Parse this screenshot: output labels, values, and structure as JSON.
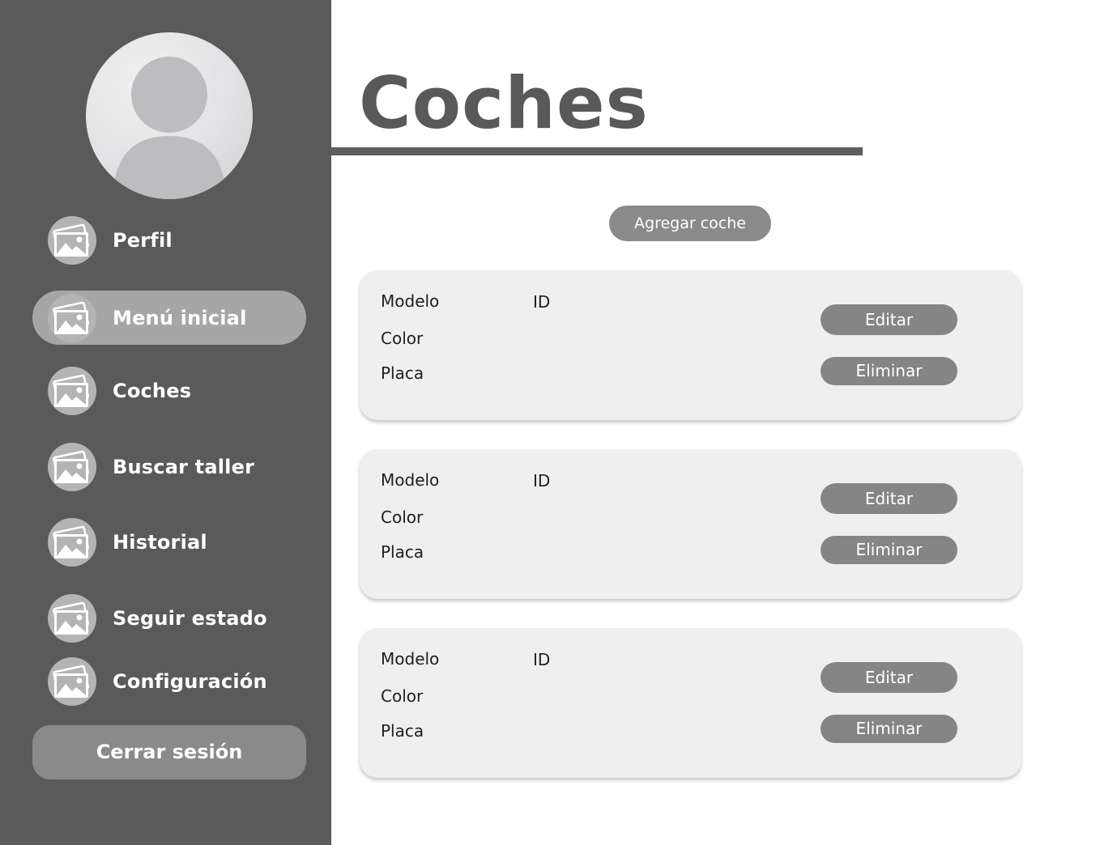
{
  "header": {
    "title": "Coches"
  },
  "sidebar": {
    "items": [
      {
        "label": "Perfil",
        "active": false
      },
      {
        "label": "Menú inicial",
        "active": true
      },
      {
        "label": "Coches",
        "active": false
      },
      {
        "label": "Buscar taller",
        "active": false
      },
      {
        "label": "Historial",
        "active": false
      },
      {
        "label": "Seguir estado",
        "active": false
      },
      {
        "label": "Configuración",
        "active": false
      }
    ],
    "logout_label": "Cerrar sesión"
  },
  "main": {
    "add_button_label": "Agregar coche",
    "cards": [
      {
        "modelo_label": "Modelo",
        "id_label": "ID",
        "color_label": "Color",
        "placa_label": "Placa",
        "edit_label": "Editar",
        "delete_label": "Eliminar"
      },
      {
        "modelo_label": "Modelo",
        "id_label": "ID",
        "color_label": "Color",
        "placa_label": "Placa",
        "edit_label": "Editar",
        "delete_label": "Eliminar"
      },
      {
        "modelo_label": "Modelo",
        "id_label": "ID",
        "color_label": "Color",
        "placa_label": "Placa",
        "edit_label": "Editar",
        "delete_label": "Eliminar"
      }
    ]
  },
  "icons": {
    "avatar": "user-avatar-icon",
    "nav": "image-placeholder-icon"
  },
  "colors": {
    "sidebar_bg": "#5a5a5a",
    "active_item_bg": "#a6a6a6",
    "button_bg": "#8a8a8a",
    "card_bg": "#efefef",
    "title_text": "#595959"
  }
}
